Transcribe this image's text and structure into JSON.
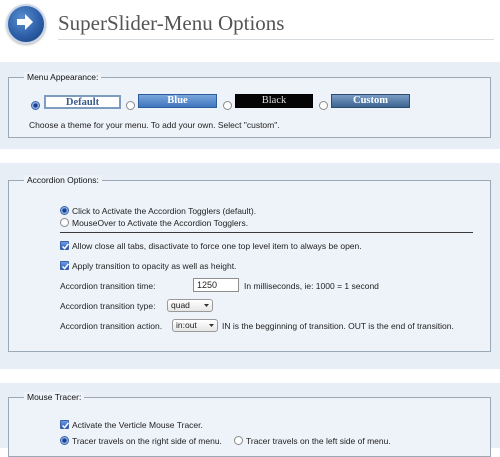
{
  "header": {
    "title": "SuperSlider-Menu Options"
  },
  "appearance": {
    "legend": "Menu Appearance:",
    "themes": [
      {
        "label": "Default",
        "selected": true
      },
      {
        "label": "Blue",
        "selected": false
      },
      {
        "label": "Black",
        "selected": false
      },
      {
        "label": "Custom",
        "selected": false
      }
    ],
    "help": "Choose a theme for your menu. To add your own. Select \"custom\"."
  },
  "accordion": {
    "legend": "Accordion Options:",
    "activate_click": "Click to Activate the Accordion Togglers (default).",
    "activate_hover": "MouseOver to Activate the Accordion Togglers.",
    "allow_close": "Allow close all tabs, disactivate to force one top level item to always be open.",
    "opacity": "Apply transition to opacity as well as height.",
    "time_label": "Accordion transition time:",
    "time_value": "1250",
    "time_hint": "In milliseconds, ie: 1000 = 1 second",
    "type_label": "Accordion transition type:",
    "type_value": "quad",
    "action_label": "Accordion transition action.",
    "action_value": "in:out",
    "action_hint": "IN is the begginning of transition. OUT is the end of transition."
  },
  "tracer": {
    "legend": "Mouse Tracer:",
    "activate": "Activate the Verticle Mouse Tracer.",
    "right_side": "Tracer travels on the right side of menu.",
    "left_side": "Tracer travels on the left side of menu."
  },
  "colors": {
    "accent": "#2d5fa8",
    "panel_bg": "#eef3f9",
    "band_bg": "#e8eef5"
  },
  "icons": {
    "logo": "arrow-right-circle-icon",
    "checkbox": "checkmark-icon",
    "select": "chevron-down-icon"
  }
}
